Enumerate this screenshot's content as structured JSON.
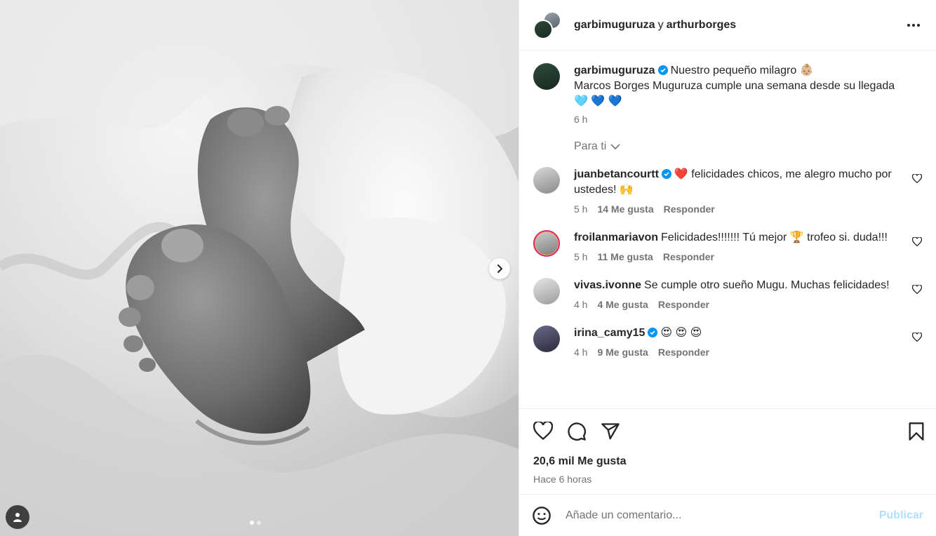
{
  "post": {
    "header": {
      "user1": "garbimuguruza",
      "conj": "y",
      "user2": "arthurborges"
    },
    "caption": {
      "username": "garbimuguruza",
      "line1": "Nuestro pequeño milagro 👶🏼",
      "line2": "Marcos Borges Muguruza cumple una semana desde su llegada",
      "line3": "🩵 💙 💙",
      "time": "6 h"
    },
    "for_you": "Para ti",
    "comments": [
      {
        "username": "juanbetancourtt",
        "verified": true,
        "text": "❤️ felicidades chicos, me alegro mucho por ustedes! 🙌",
        "time": "5 h",
        "likes": "14 Me gusta",
        "reply": "Responder"
      },
      {
        "username": "froilanmariavon",
        "verified": false,
        "text": "Felicidades!!!!!!! Tú mejor 🏆 trofeo si. duda!!!",
        "time": "5 h",
        "likes": "11 Me gusta",
        "reply": "Responder"
      },
      {
        "username": "vivas.ivonne",
        "verified": false,
        "text": "Se cumple otro sueño Mugu. Muchas felicidades!",
        "time": "4 h",
        "likes": "4 Me gusta",
        "reply": "Responder"
      },
      {
        "username": "irina_camy15",
        "verified": true,
        "text": "😍 😍 😍",
        "time": "4 h",
        "likes": "9 Me gusta",
        "reply": "Responder"
      }
    ],
    "likes_count": "20,6 mil Me gusta",
    "posted_ago": "Hace 6 horas",
    "compose": {
      "placeholder": "Añade un comentario...",
      "publish": "Publicar"
    },
    "colors": {
      "verified": "#0095f6",
      "publish_disabled": "#b2dffc",
      "secondary_text": "#737373"
    },
    "icons": [
      "next-arrow-icon",
      "user-tag-icon",
      "more-options-icon",
      "verified-icon",
      "chevron-down-icon",
      "heart-icon",
      "comment-icon",
      "share-icon",
      "bookmark-icon",
      "emoji-icon"
    ]
  }
}
